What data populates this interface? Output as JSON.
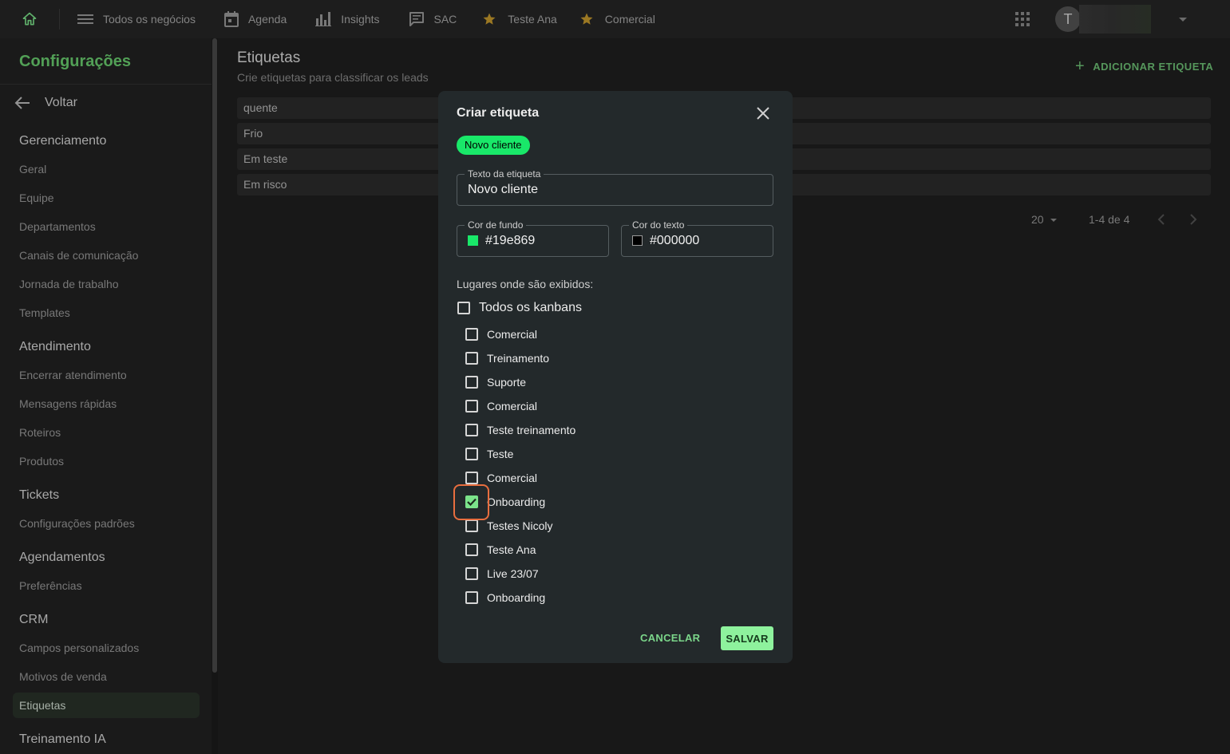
{
  "topbar": {
    "nav": [
      {
        "label": "Todos os negócios",
        "icon": "menu-icon"
      },
      {
        "label": "Agenda",
        "icon": "calendar-icon"
      },
      {
        "label": "Insights",
        "icon": "bar-chart-icon"
      },
      {
        "label": "SAC",
        "icon": "chat-icon"
      },
      {
        "label": "Teste Ana",
        "icon": "star-icon"
      },
      {
        "label": "Comercial",
        "icon": "star-icon"
      }
    ],
    "avatar_initial": "T"
  },
  "sidebar": {
    "title": "Configurações",
    "back_label": "Voltar",
    "sections": [
      {
        "title": "Gerenciamento",
        "items": [
          "Geral",
          "Equipe",
          "Departamentos",
          "Canais de comunicação",
          "Jornada de trabalho",
          "Templates"
        ]
      },
      {
        "title": "Atendimento",
        "items": [
          "Encerrar atendimento",
          "Mensagens rápidas",
          "Roteiros",
          "Produtos"
        ]
      },
      {
        "title": "Tickets",
        "items": [
          "Configurações padrões"
        ]
      },
      {
        "title": "Agendamentos",
        "items": [
          "Preferências"
        ]
      },
      {
        "title": "CRM",
        "items": [
          "Campos personalizados",
          "Motivos de venda",
          "Etiquetas"
        ]
      },
      {
        "title": "Treinamento IA",
        "items": []
      }
    ],
    "active_item": "Etiquetas"
  },
  "main": {
    "title": "Etiquetas",
    "subtitle": "Crie etiquetas para classificar os leads",
    "add_button": "ADICIONAR ETIQUETA",
    "tags": [
      "quente",
      "Frio",
      "Em teste",
      "Em risco"
    ],
    "rows_per_page": "20",
    "range": "1-4 de 4"
  },
  "modal": {
    "title": "Criar etiqueta",
    "preview_chip": "Novo cliente",
    "text_field": {
      "label": "Texto da etiqueta",
      "value": "Novo cliente"
    },
    "bg_color_field": {
      "label": "Cor de fundo",
      "value": "#19e869",
      "color": "#19e869"
    },
    "text_color_field": {
      "label": "Cor do texto",
      "value": "#000000",
      "color": "#000000"
    },
    "places_label": "Lugares onde são exibidos:",
    "all_kanbans": {
      "label": "Todos os kanbans",
      "checked": false
    },
    "kanbans": [
      {
        "label": "Comercial",
        "checked": false
      },
      {
        "label": "Treinamento",
        "checked": false
      },
      {
        "label": "Suporte",
        "checked": false
      },
      {
        "label": "Comercial",
        "checked": false
      },
      {
        "label": "Teste treinamento",
        "checked": false
      },
      {
        "label": "Teste",
        "checked": false
      },
      {
        "label": "Comercial",
        "checked": false
      },
      {
        "label": "Onboarding",
        "checked": true
      },
      {
        "label": "Testes Nicoly",
        "checked": false
      },
      {
        "label": "Teste Ana",
        "checked": false
      },
      {
        "label": "Live 23/07",
        "checked": false
      },
      {
        "label": "Onboarding",
        "checked": false
      }
    ],
    "cancel_label": "CANCELAR",
    "save_label": "SALVAR"
  }
}
